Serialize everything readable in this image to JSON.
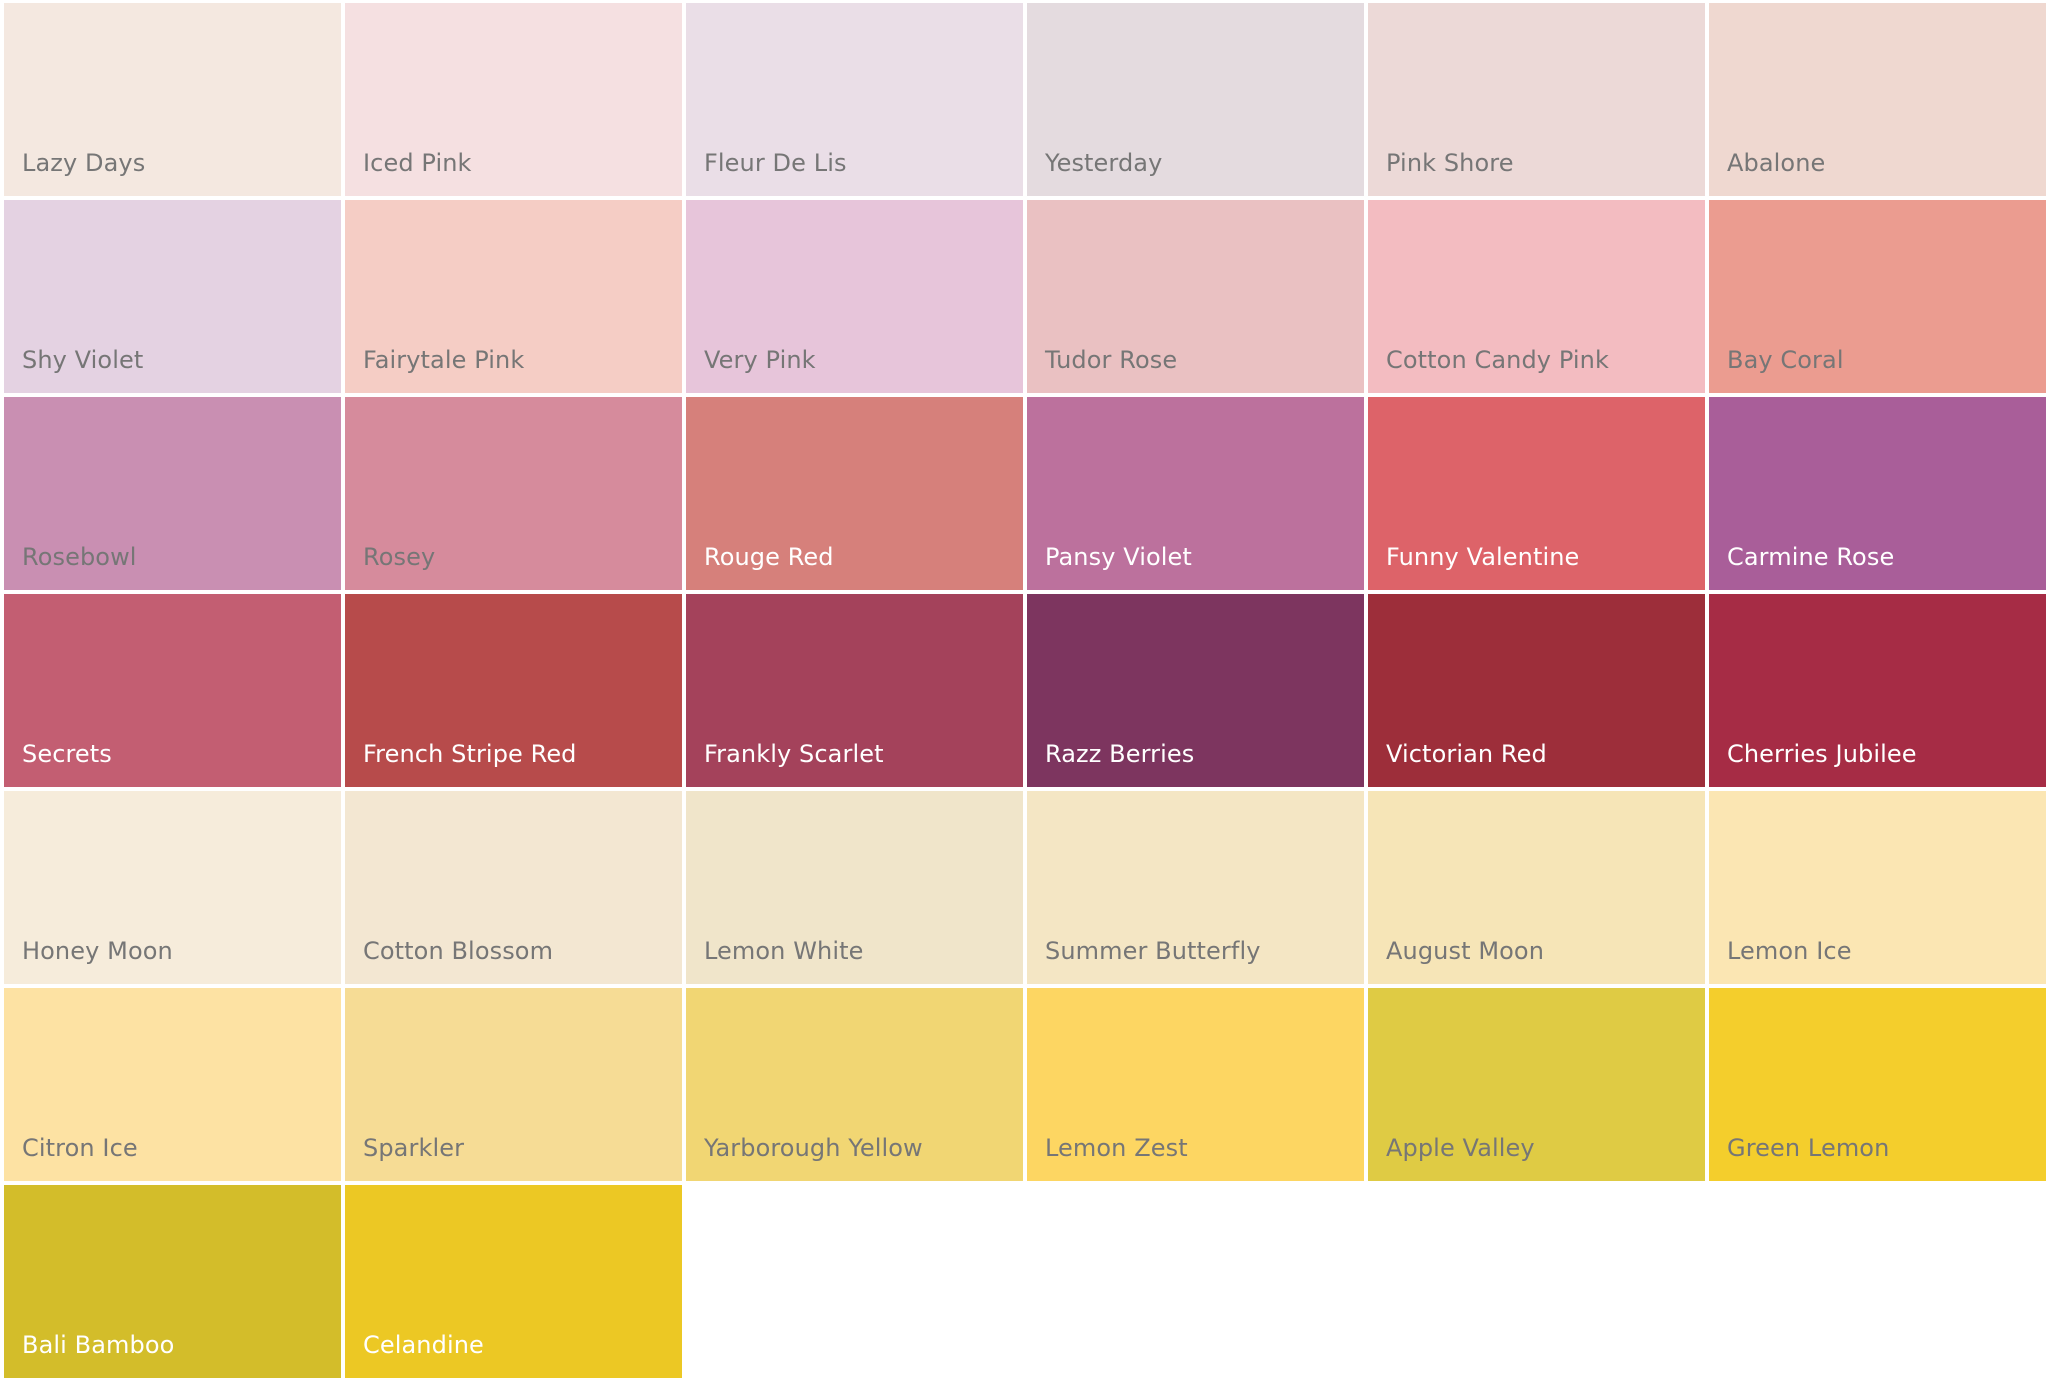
{
  "swatches": [
    {
      "name": "Lazy Days",
      "color": "#f4e8e0",
      "text": "light"
    },
    {
      "name": "Iced Pink",
      "color": "#f5e0e1",
      "text": "light"
    },
    {
      "name": "Fleur De Lis",
      "color": "#eadee7",
      "text": "light"
    },
    {
      "name": "Yesterday",
      "color": "#e4dbdf",
      "text": "light"
    },
    {
      "name": "Pink Shore",
      "color": "#ecd9d7",
      "text": "light"
    },
    {
      "name": "Abalone",
      "color": "#efd8d0",
      "text": "light"
    },
    {
      "name": "Shy Violet",
      "color": "#e4d2e2",
      "text": "light"
    },
    {
      "name": "Fairytale Pink",
      "color": "#f5cdc5",
      "text": "light"
    },
    {
      "name": "Very Pink",
      "color": "#e7c5da",
      "text": "light"
    },
    {
      "name": "Tudor Rose",
      "color": "#eac1c2",
      "text": "light"
    },
    {
      "name": "Cotton Candy Pink",
      "color": "#f3bcc1",
      "text": "light"
    },
    {
      "name": "Bay Coral",
      "color": "#eb9c90",
      "text": "light"
    },
    {
      "name": "Rosebowl",
      "color": "#c98fb2",
      "text": "light"
    },
    {
      "name": "Rosey",
      "color": "#d68b9c",
      "text": "light"
    },
    {
      "name": "Rouge Red",
      "color": "#d6807b",
      "text": "dark"
    },
    {
      "name": "Pansy Violet",
      "color": "#bc719d",
      "text": "dark"
    },
    {
      "name": "Funny Valentine",
      "color": "#dd6369",
      "text": "dark"
    },
    {
      "name": "Carmine Rose",
      "color": "#a95e99",
      "text": "dark"
    },
    {
      "name": "Secrets",
      "color": "#c35e72",
      "text": "dark"
    },
    {
      "name": "French Stripe Red",
      "color": "#b74b4b",
      "text": "dark"
    },
    {
      "name": "Frankly Scarlet",
      "color": "#a4425b",
      "text": "dark"
    },
    {
      "name": "Razz Berries",
      "color": "#7d355f",
      "text": "dark"
    },
    {
      "name": "Victorian Red",
      "color": "#9d2e3a",
      "text": "dark"
    },
    {
      "name": "Cherries Jubilee",
      "color": "#a62c45",
      "text": "dark"
    },
    {
      "name": "Honey Moon",
      "color": "#f6ecdb",
      "text": "light"
    },
    {
      "name": "Cotton Blossom",
      "color": "#f3e7d2",
      "text": "light"
    },
    {
      "name": "Lemon White",
      "color": "#f0e5ca",
      "text": "light"
    },
    {
      "name": "Summer Butterfly",
      "color": "#f4e6c4",
      "text": "light"
    },
    {
      "name": "August Moon",
      "color": "#f6e5b7",
      "text": "light"
    },
    {
      "name": "Lemon Ice",
      "color": "#fbe6b3",
      "text": "light"
    },
    {
      "name": "Citron Ice",
      "color": "#fde2a3",
      "text": "light"
    },
    {
      "name": "Sparkler",
      "color": "#f6dc95",
      "text": "light"
    },
    {
      "name": "Yarborough Yellow",
      "color": "#f1d673",
      "text": "light"
    },
    {
      "name": "Lemon Zest",
      "color": "#fdd662",
      "text": "light"
    },
    {
      "name": "Apple Valley",
      "color": "#dfcb44",
      "text": "light"
    },
    {
      "name": "Green Lemon",
      "color": "#f4ce2c",
      "text": "light"
    },
    {
      "name": "Bali Bamboo",
      "color": "#d3bd2a",
      "text": "dark"
    },
    {
      "name": "Celandine",
      "color": "#ecc824",
      "text": "dark"
    }
  ]
}
